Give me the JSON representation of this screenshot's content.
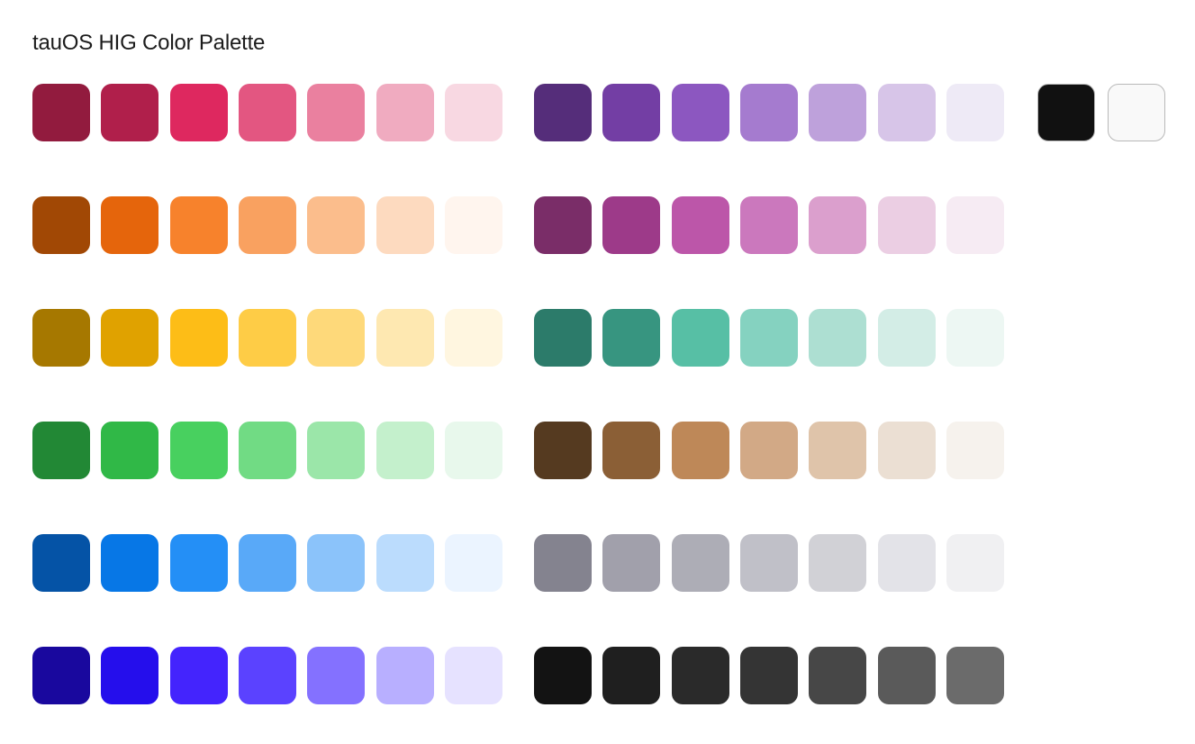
{
  "title": "tauOS HIG Color Palette",
  "palette": {
    "left_group": [
      {
        "name": "red",
        "colors": [
          "#921b3e",
          "#b01f4b",
          "#de285f",
          "#e35681",
          "#ea809f",
          "#f0abc0",
          "#f8d8e2"
        ]
      },
      {
        "name": "orange",
        "colors": [
          "#a14805",
          "#e5650c",
          "#f7822c",
          "#f9a160",
          "#fbbd8c",
          "#fddabf",
          "#fff5ee"
        ]
      },
      {
        "name": "yellow",
        "colors": [
          "#a67800",
          "#e0a200",
          "#fdbd17",
          "#fecc46",
          "#fed97a",
          "#fee8b1",
          "#fff6e0"
        ]
      },
      {
        "name": "green",
        "colors": [
          "#228835",
          "#30b847",
          "#48d05f",
          "#71db84",
          "#9be6a9",
          "#c4f0cc",
          "#e8f8ec"
        ]
      },
      {
        "name": "blue",
        "colors": [
          "#0553a6",
          "#0777e6",
          "#248ff6",
          "#59a9f8",
          "#8bc3fa",
          "#bbdcfd",
          "#ebf4ff"
        ]
      },
      {
        "name": "indigo",
        "colors": [
          "#19089e",
          "#250eec",
          "#4424fd",
          "#5b42ff",
          "#8471ff",
          "#b8afff",
          "#e6e2ff"
        ]
      }
    ],
    "right_group": [
      {
        "name": "purple",
        "colors": [
          "#552d7a",
          "#733ea4",
          "#8c57c0",
          "#a57bcf",
          "#bea1db",
          "#d7c5e8",
          "#eeeaf6"
        ]
      },
      {
        "name": "pink",
        "colors": [
          "#7a2d68",
          "#9d3a89",
          "#bc56a9",
          "#cb78bd",
          "#db9fcd",
          "#ebcee3",
          "#f6ebf3"
        ]
      },
      {
        "name": "teal",
        "colors": [
          "#2c7b6a",
          "#379580",
          "#57bfa5",
          "#85d2c0",
          "#addfd2",
          "#d3ede6",
          "#edf7f3"
        ]
      },
      {
        "name": "brown",
        "colors": [
          "#553a20",
          "#8b5f36",
          "#be8858",
          "#d2a986",
          "#dfc4aa",
          "#ebdfd3",
          "#f6f2ed"
        ]
      },
      {
        "name": "gray",
        "colors": [
          "#84838f",
          "#a1a0ab",
          "#adadb6",
          "#c0c0c8",
          "#d1d1d6",
          "#e3e3e8",
          "#f0f0f2"
        ]
      },
      {
        "name": "dark",
        "colors": [
          "#131313",
          "#1f1f1f",
          "#2a2a2a",
          "#343434",
          "#474747",
          "#5a5a5a",
          "#6b6b6b"
        ]
      }
    ],
    "extra": [
      {
        "name": "black",
        "color": "#111111",
        "outlined": true
      },
      {
        "name": "white",
        "color": "#f9f9f9",
        "outlined": true
      }
    ]
  }
}
